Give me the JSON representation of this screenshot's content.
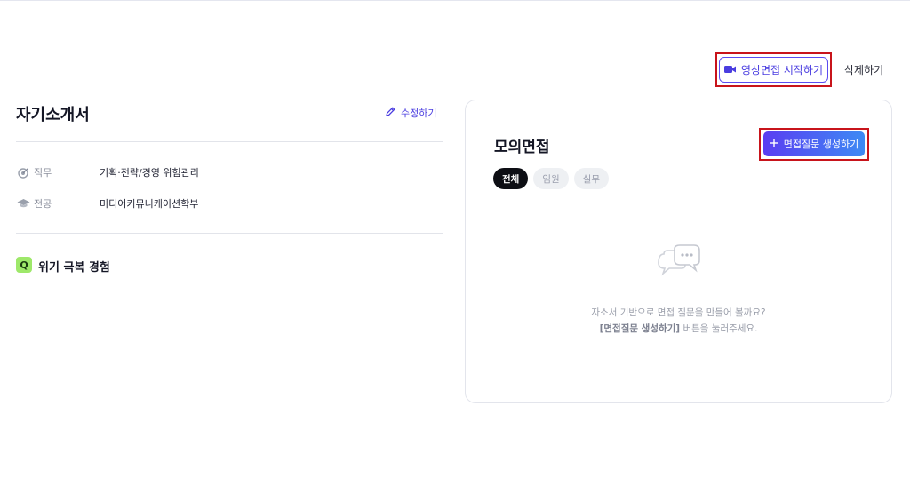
{
  "header": {
    "video_interview_label": "영상면접 시작하기",
    "delete_label": "삭제하기"
  },
  "resume": {
    "title": "자기소개서",
    "edit_label": "수정하기",
    "fields": [
      {
        "key": "직무",
        "value": "기획·전략/경영 위험관리"
      },
      {
        "key": "전공",
        "value": "미디어커뮤니케이션학부"
      }
    ],
    "question": {
      "badge": "Q",
      "title": "위기 극복 경험"
    }
  },
  "mock_interview": {
    "title": "모의면접",
    "generate_label": "면접질문 생성하기",
    "tabs": [
      "전체",
      "임원",
      "실무"
    ],
    "active_tab": 0,
    "empty": {
      "line1": "자소서 기반으로 면접 질문을 만들어 볼까요?",
      "line2_bold": "[면접질문 생성하기]",
      "line2_rest": " 버튼을 눌러주세요."
    }
  },
  "colors": {
    "accent": "#4a3de0",
    "gradient_start": "#5a3df2",
    "gradient_end": "#3d8af4",
    "highlight_frame": "#c8141b",
    "q_badge": "#9ee86a"
  }
}
